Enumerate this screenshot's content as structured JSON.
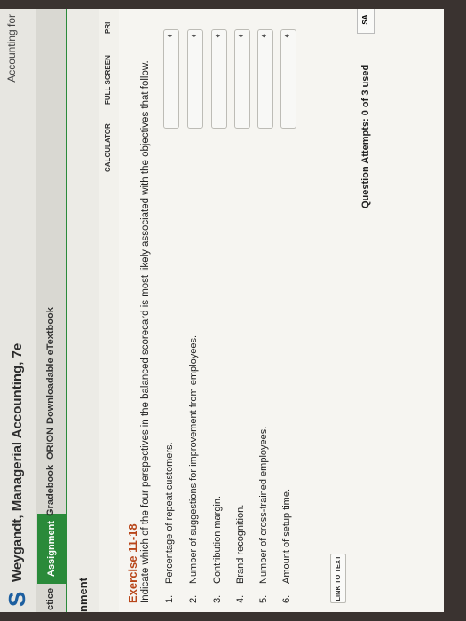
{
  "header": {
    "logo": "S",
    "book_title": "Weygandt, Managerial Accounting, 7e",
    "course_title": "Accounting for"
  },
  "tabs": [
    {
      "label": "ctice"
    },
    {
      "label": "Assignment"
    },
    {
      "label": "Gradebook"
    },
    {
      "label": "ORION"
    },
    {
      "label": "Downloadable eTextbook"
    }
  ],
  "subhead": "nment",
  "toolbar": {
    "calculator": "CALCULATOR",
    "full_screen": "FULL SCREEN",
    "print": "PRI"
  },
  "exercise": {
    "title": "Exercise 11-18",
    "instructions": "Indicate which of the four perspectives in the balanced scorecard is most likely associated with the objectives that follow.",
    "items": [
      {
        "num": "1.",
        "text": "Percentage of repeat customers."
      },
      {
        "num": "2.",
        "text": "Number of suggestions for improvement from employees."
      },
      {
        "num": "3.",
        "text": "Contribution margin."
      },
      {
        "num": "4.",
        "text": "Brand recognition."
      },
      {
        "num": "5.",
        "text": "Number of cross-trained employees."
      },
      {
        "num": "6.",
        "text": "Amount of setup time."
      }
    ],
    "dropdown_arrow": "♦"
  },
  "link_to_text": "LINK TO TEXT",
  "attempts": "Question Attempts: 0 of 3 used",
  "save": "SA"
}
